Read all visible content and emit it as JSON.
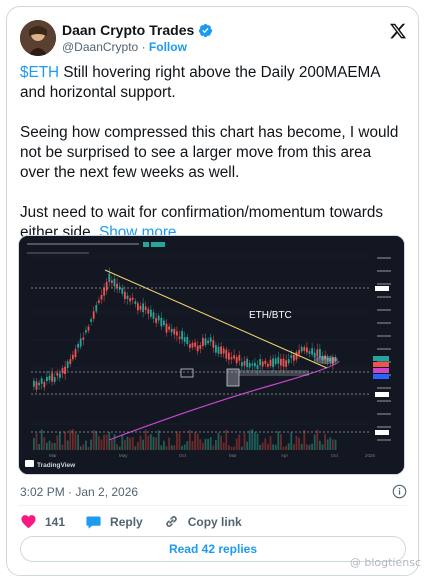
{
  "author": {
    "display_name": "Daan Crypto Trades",
    "handle": "@DaanCrypto",
    "separator": "·",
    "follow_label": "Follow"
  },
  "icons": {
    "verified": "verified-badge-icon",
    "platform": "x-logo-icon",
    "info": "info-icon",
    "like": "heart-icon",
    "reply": "speech-bubble-icon",
    "copy_link": "link-icon"
  },
  "tweet": {
    "cashtag": "$ETH",
    "p1_rest": " Still hovering right above the Daily 200MAEMA and horizontal support.",
    "p2": "Seeing how compressed this chart has become, I would not be surprised to see a larger move from this area over the next few weeks as well.",
    "p3": "Just need to wait for confirmation/momentum towards either side,",
    "show_more": "Show more"
  },
  "chart": {
    "label": "ETH/BTC",
    "brand": "TradingView",
    "x_labels": [
      "Mar",
      "May",
      "Oct",
      "Mar",
      "Apr",
      "Oct",
      "2026"
    ]
  },
  "meta": {
    "timestamp": "3:02 PM · Jan 2, 2026"
  },
  "actions": {
    "like_count": "141",
    "reply_label": "Reply",
    "copy_link_label": "Copy link"
  },
  "read_replies_label": "Read 42 replies",
  "watermark": "@ blogtiensc",
  "colors": {
    "accent": "#1d9bf0",
    "like": "#f91880",
    "chart_bg": "#131722",
    "up_candle": "#26a69a",
    "down_candle": "#ef5350",
    "trendline": "#f5d76e",
    "ma_line": "#c847c8"
  }
}
